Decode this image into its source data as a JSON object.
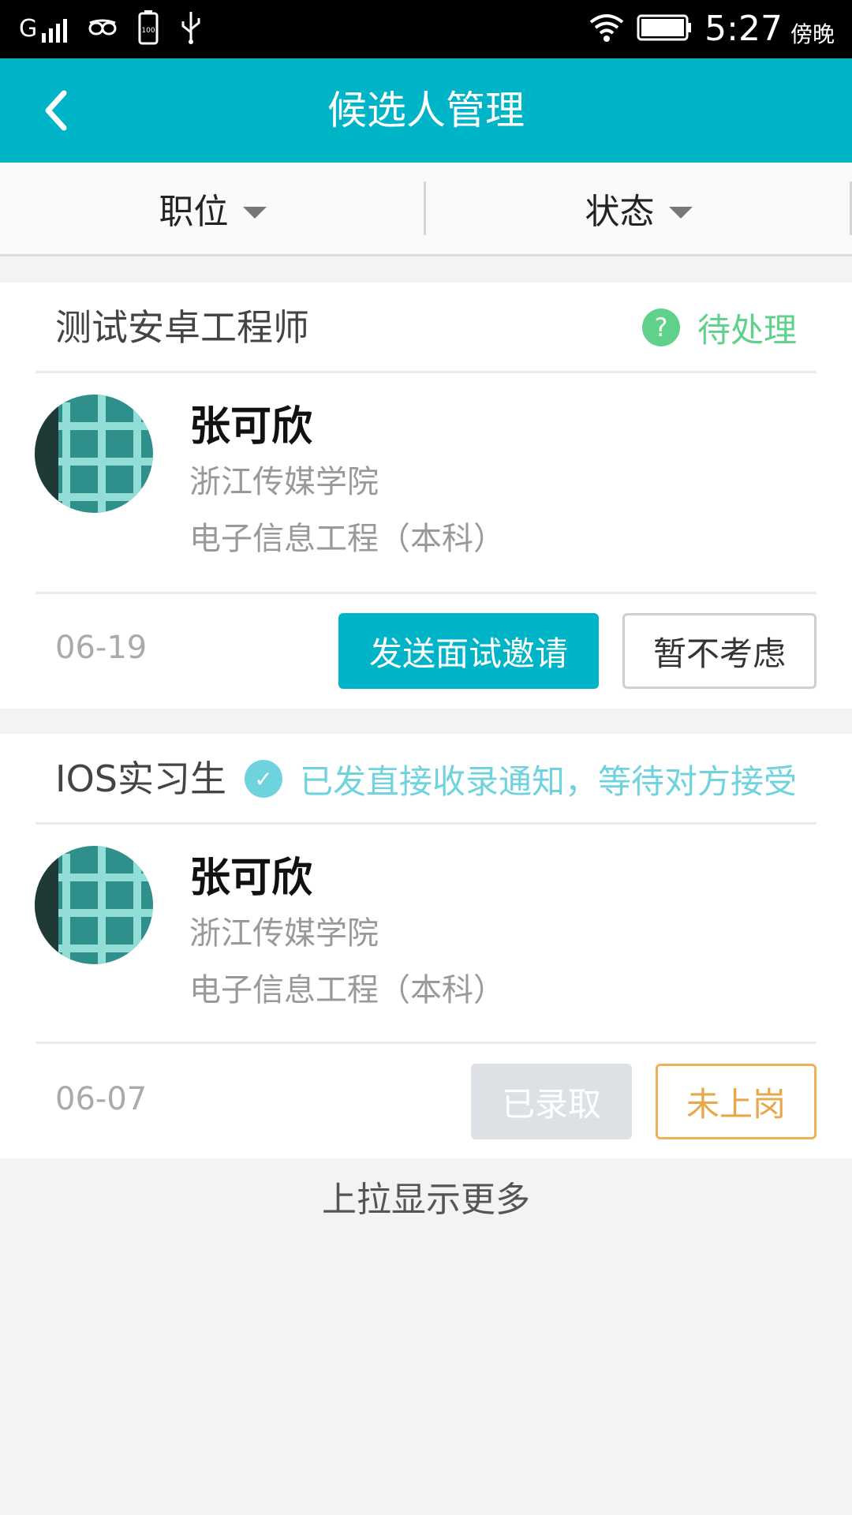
{
  "statusbar": {
    "time": "5:27",
    "ampm": "傍晚",
    "battery_label": "100",
    "signal_label": "G"
  },
  "appbar": {
    "title": "候选人管理"
  },
  "filters": [
    {
      "label": "职位"
    },
    {
      "label": "状态"
    }
  ],
  "cards": [
    {
      "job": "测试安卓工程师",
      "status_text": "待处理",
      "status_icon": "question-icon",
      "status_color": "#5fd18a",
      "name": "张可欣",
      "school": "浙江传媒学院",
      "major": "电子信息工程（本科）",
      "date": "06-19",
      "primary_btn": "发送面试邀请",
      "secondary_btn": "暂不考虑"
    },
    {
      "job": "IOS实习生",
      "status_text": "已发直接收录通知，等待对方接受",
      "status_icon": "check-icon",
      "status_color": "#6fd3df",
      "name": "张可欣",
      "school": "浙江传媒学院",
      "major": "电子信息工程（本科）",
      "date": "06-07",
      "primary_btn": "已录取",
      "secondary_btn": "未上岗"
    }
  ],
  "footer": {
    "more": "上拉显示更多"
  },
  "colors": {
    "accent": "#00b4c8",
    "pending_green": "#5fd18a",
    "notice_cyan": "#6fd3df",
    "orange": "#f0b05a"
  }
}
